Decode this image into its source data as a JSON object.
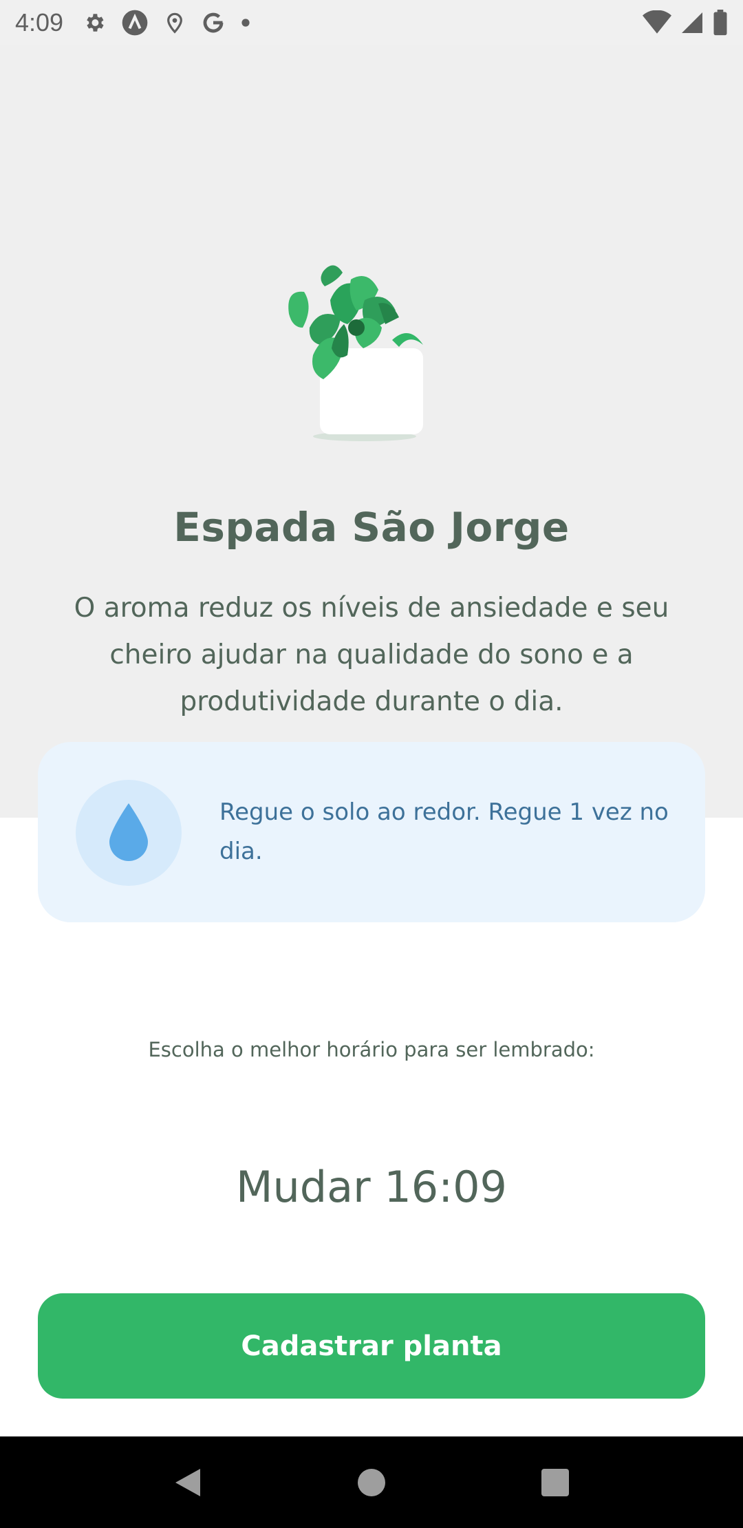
{
  "status_bar": {
    "time": "4:09",
    "left_icons": [
      "gear-icon",
      "app-a-icon",
      "location-icon",
      "google-icon",
      "dot-icon"
    ],
    "right_icons": [
      "wifi-icon",
      "signal-icon",
      "battery-icon"
    ]
  },
  "plant": {
    "name": "Espada São Jorge",
    "about": "O aroma reduz os níveis de ansiedade e seu cheiro ajudar na qualidade do sono e a produtividade durante o dia."
  },
  "tip": {
    "icon": "water-drop-icon",
    "text": "Regue o solo ao redor. Regue 1 vez no dia."
  },
  "reminder": {
    "label": "Escolha o melhor horário para ser lembrado:",
    "time_button": "Mudar 16:09"
  },
  "actions": {
    "register": "Cadastrar planta"
  },
  "colors": {
    "green": "#32b768",
    "heading": "#52665a",
    "blue_text": "#3d7199",
    "tip_bg": "#eaf4fd",
    "header_bg": "#efefef"
  }
}
